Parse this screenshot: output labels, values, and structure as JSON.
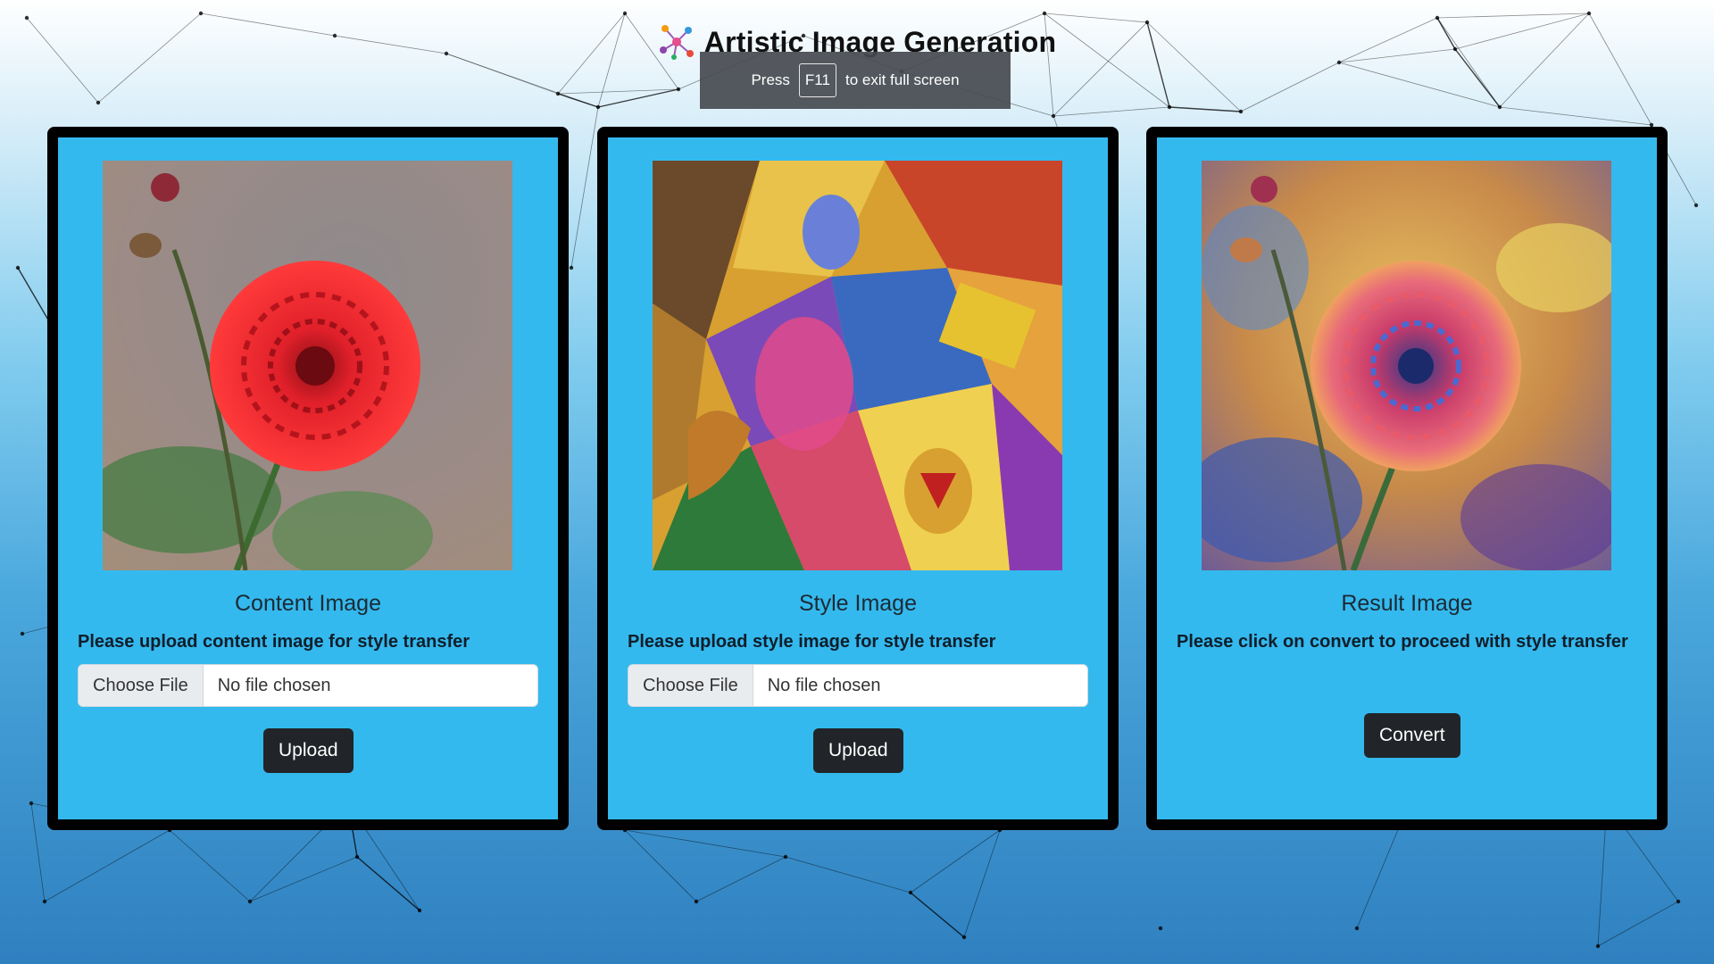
{
  "app": {
    "title": "Artistic Image Generation"
  },
  "fullscreen_notice": {
    "prefix": "Press",
    "key": "F11",
    "suffix": "to exit full screen"
  },
  "cards": [
    {
      "title": "Content Image",
      "description": "Please upload content image for style transfer",
      "choose_file_label": "Choose File",
      "file_status": "No file chosen",
      "button_label": "Upload"
    },
    {
      "title": "Style Image",
      "description": "Please upload style image for style transfer",
      "choose_file_label": "Choose File",
      "file_status": "No file chosen",
      "button_label": "Upload"
    },
    {
      "title": "Result Image",
      "description": "Please click on convert to proceed with style transfer",
      "button_label": "Convert"
    }
  ],
  "colors": {
    "card_background": "#34b9ee",
    "card_border": "#000000",
    "button_dark": "#212529",
    "flower_red": "#e0202a"
  }
}
